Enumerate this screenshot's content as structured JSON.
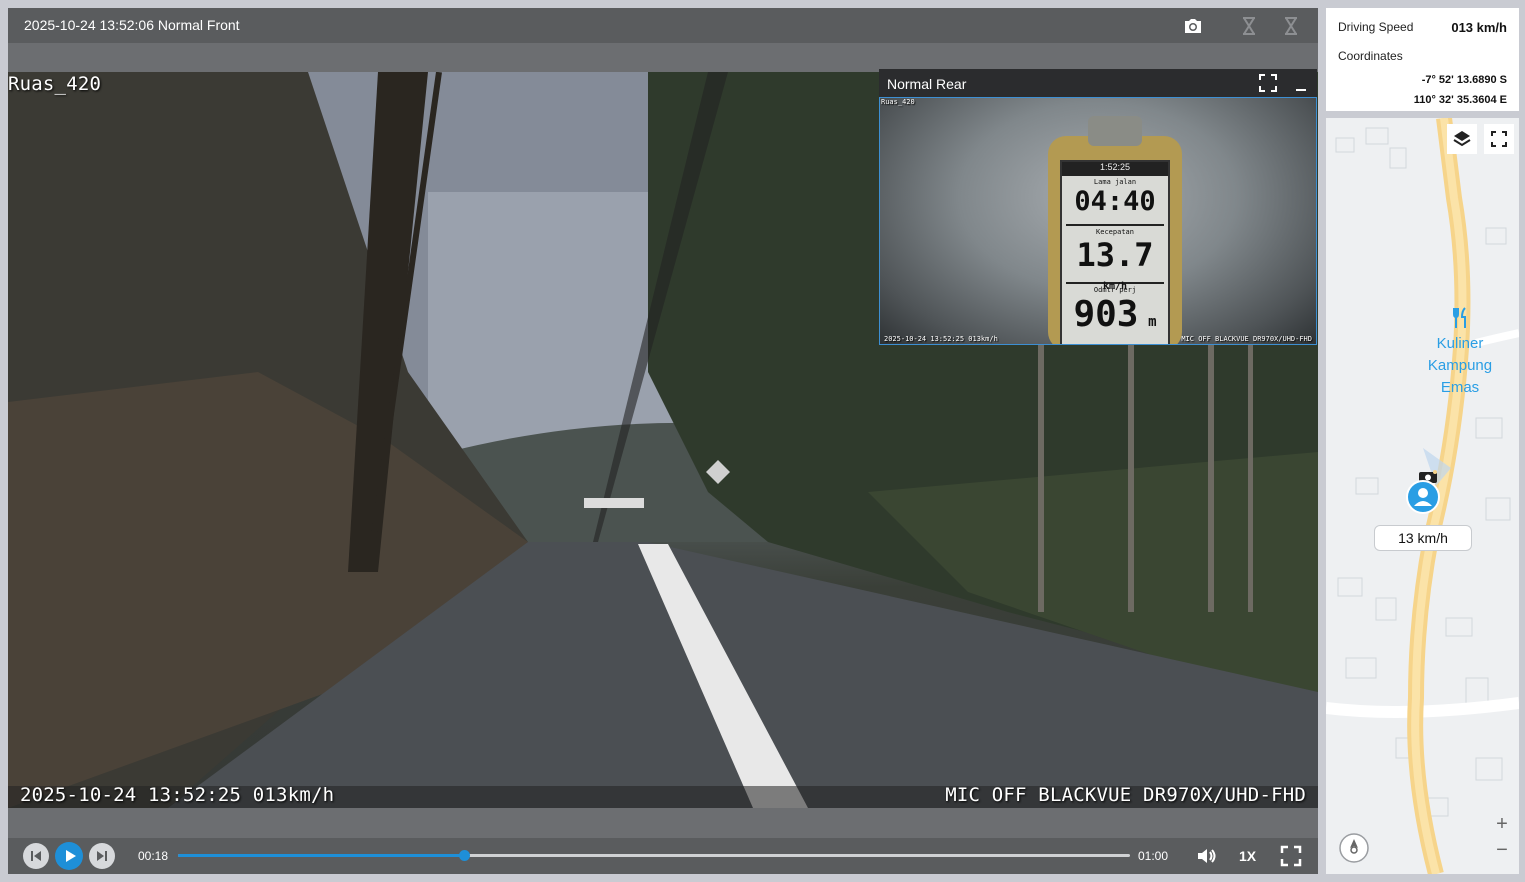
{
  "player": {
    "title": "2025-10-24 13:52:06 Normal Front",
    "icons": {
      "snapshot": "camera-icon",
      "sync": "hourglass-icon",
      "compare": "hourglass-icon"
    },
    "front_overlay": {
      "top_left": "Ruas_420",
      "bottom_left": "2025-10-24 13:52:25 013km/h",
      "bottom_right": "MIC OFF BLACKVUE DR970X/UHD-FHD"
    },
    "rear": {
      "title": "Normal Rear",
      "overlay_top": "Ruas_420",
      "overlay_bottom_left": "2025-10-24 13:52:25 013km/h",
      "overlay_bottom_right": "MIC OFF BLACKVUE DR970X/UHD-FHD",
      "gps_device": {
        "clock": "1:52:25",
        "label1": "Lama jalan",
        "value1": "04:40",
        "label2": "Kecepatan",
        "value2": "13.7",
        "unit2": "km/h",
        "label3": "Odmtr perj",
        "value3": "903",
        "unit3": "m"
      }
    },
    "controls": {
      "current_time": "00:18",
      "total_time": "01:00",
      "progress_fraction": 0.3,
      "speed_label": "1X"
    }
  },
  "info": {
    "speed_label": "Driving Speed",
    "speed_value": "013 km/h",
    "coords_label": "Coordinates",
    "lat": "-7° 52' 13.6890 S",
    "lon": "110° 32' 35.3604 E"
  },
  "map": {
    "poi_name_1": "Kuliner",
    "poi_name_2": "Kampung",
    "poi_name_3": "Emas",
    "speed_tag": "13 km/h",
    "zoom_in": "+",
    "zoom_out": "−",
    "colors": {
      "road": "#f6d48a",
      "poi": "#2a9ee4",
      "marker": "#2a9ee4"
    }
  }
}
